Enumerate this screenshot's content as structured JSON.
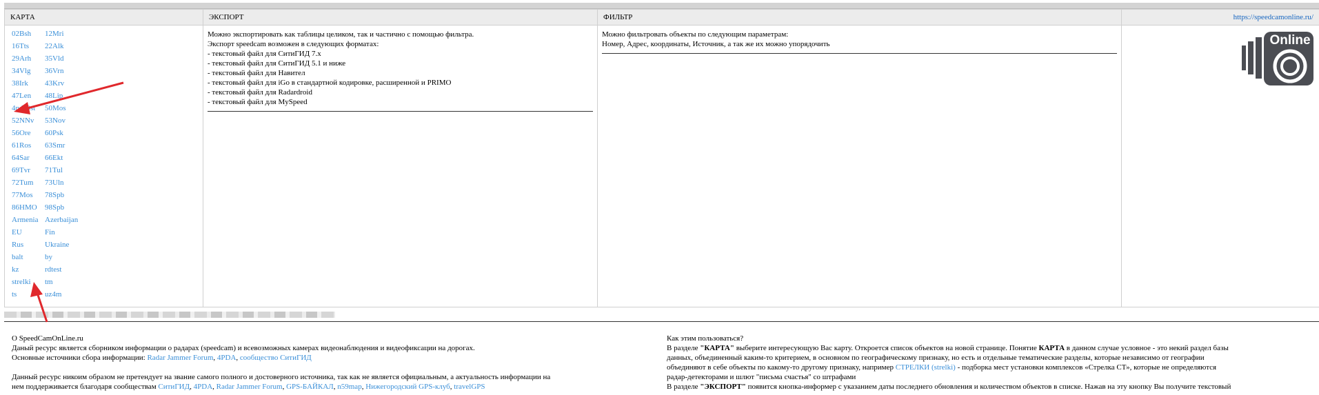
{
  "header": {
    "col_map": "КАРТА",
    "col_export": "ЭКСПОРТ",
    "col_filter": "ФИЛЬТР",
    "site_link": "https://speedcamonline.ru/"
  },
  "maps": [
    [
      "02Bsh",
      "12Mri"
    ],
    [
      "16Tts",
      "22Alk"
    ],
    [
      "29Arh",
      "35Vld"
    ],
    [
      "34Vlg",
      "36Vrn"
    ],
    [
      "38Irk",
      "43Krv"
    ],
    [
      "47Len",
      "48Lip"
    ],
    [
      "4pda0st",
      "50Mos"
    ],
    [
      "52NNv",
      "53Nov"
    ],
    [
      "56Ore",
      "60Psk"
    ],
    [
      "61Ros",
      "63Smr"
    ],
    [
      "64Sar",
      "66Ekt"
    ],
    [
      "69Tvr",
      "71Tul"
    ],
    [
      "72Tum",
      "73Uln"
    ],
    [
      "77Mos",
      "78Spb"
    ],
    [
      "86HMO",
      "98Spb"
    ],
    [
      "Armenia",
      "Azerbaijan"
    ],
    [
      "EU",
      "Fin"
    ],
    [
      "Rus",
      "Ukraine"
    ],
    [
      "balt",
      "by"
    ],
    [
      "kz",
      "rdtest"
    ],
    [
      "strelki",
      "tm"
    ],
    [
      "ts",
      "uz4m"
    ]
  ],
  "export": {
    "lines": [
      "Можно экспортировать как таблицы целиком, так и частично с помощью фильтра.",
      "Экспорт speedcam возможен в следующих форматах:",
      "- текстовый файл для СитиГИД 7.x",
      "- текстовый файл для СитиГИД 5.1 и ниже",
      "- текстовый файл для Навител",
      "- текстовый файл для iGo в стандартной кодировке, расширенной и PRIMO",
      "- текстовый файл для Radardroid",
      "- текстовый файл для MySpeed"
    ]
  },
  "filter": {
    "lines": [
      "Можно фильтровать объекты по следующим параметрам:",
      "Номер, Адрес, координаты, Источник, а так же их можно упорядочить"
    ]
  },
  "logo": {
    "text": "Online"
  },
  "about": {
    "title": "О SpeedCamOnLine.ru",
    "line1": "Даный ресурс является сборником информации о радарах (speedcam) и всевозможных камерах видеонаблюдения и видеофиксации на дорогах.",
    "sources_prefix": "Основные источники сбора информации: ",
    "src1": "Radar Jammer Forum",
    "comma": ", ",
    "src2": "4PDA",
    "src3": "сообщество СитиГИД",
    "line3a": "Данный ресурс никоим образом не претендует на звание самого полного и достоверного источника, так как не является официальным, а актуальность информации на",
    "line3b": "нем поддерживается благодаря сообществам ",
    "c1": "СитиГИД",
    "c2": "4PDA",
    "c3": "Radar Jammer Forum",
    "c4": "GPS-БАЙКАЛ",
    "c5": "n59map",
    "c6": "Нижегородский GPS-клуб",
    "c7": "travelGPS"
  },
  "howto": {
    "title": "Как этим пользоваться?",
    "p1a": "В разделе ",
    "p1b": "\"КАРТА\"",
    "p1c": " выберите интересующую Вас карту. Откроется список объектов на новой странице. Понятие ",
    "p1d": "КАРТА",
    "p1e": " в данном случае условное - это некий раздел базы",
    "p1f": "данных, объединенный каким-то критерием, в основном по географическому признаку, но есть и отдельные тематические разделы, которые независимо от географии",
    "p1g": "объединяют в себе объекты по какому-то другому признаку, например ",
    "p1link": "СТРЕЛКИ (strelki)",
    "p1h": " - подборка мест установки комплексов «Стрелка СТ», которые не определяются",
    "p1i": "радар-детекторами и шлют \"письма счастья\" со штрафами",
    "p2a": "В разделе ",
    "p2b": "\"ЭКСПОРТ\"",
    "p2c": " появится кнопка-информер с указанием даты последнего обновления и количеством объектов в списке. Нажав на эту кнопку Вы получите текстовый"
  },
  "colors": {
    "link": "#3a8fd8",
    "header_bg": "#ececec",
    "arrow": "#e0282c",
    "logo_dark": "#4b4d53"
  }
}
